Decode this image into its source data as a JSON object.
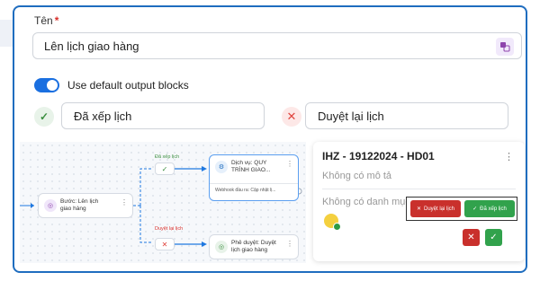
{
  "form": {
    "name_label": "Tên",
    "required_mark": "*",
    "name_value": "Lên lịch giao hàng",
    "default_output_label": "Use default output blocks",
    "output_success_value": "Đã xếp lịch",
    "output_fail_value": "Duyệt lại lịch"
  },
  "diagram": {
    "start_node": {
      "label_line1": "Bước: Lên lịch",
      "label_line2": "giao hàng"
    },
    "edge_top_label": "Đã xếp lịch",
    "edge_bottom_label": "Duyệt lại lịch",
    "service_node": {
      "label_line1": "Dịch vụ: QUY",
      "label_line2": "TRÌNH GIAO...",
      "footer": "Webhook đầu ra: Cập nhật lị..."
    },
    "approve_node": {
      "label_line1": "Phê duyệt: Duyệt",
      "label_line2": "lịch giao hàng"
    }
  },
  "detail_card": {
    "title": "IHZ - 19122024 - HD01",
    "description": "Không có mô tả",
    "category": "Không có danh mục",
    "btn_review": "Duyệt lại lịch",
    "btn_scheduled": "Đã xếp lịch"
  },
  "colors": {
    "accent": "#1f6dbf",
    "success": "#31a24c",
    "danger": "#c9302c",
    "toggle": "#1a6fe0"
  }
}
